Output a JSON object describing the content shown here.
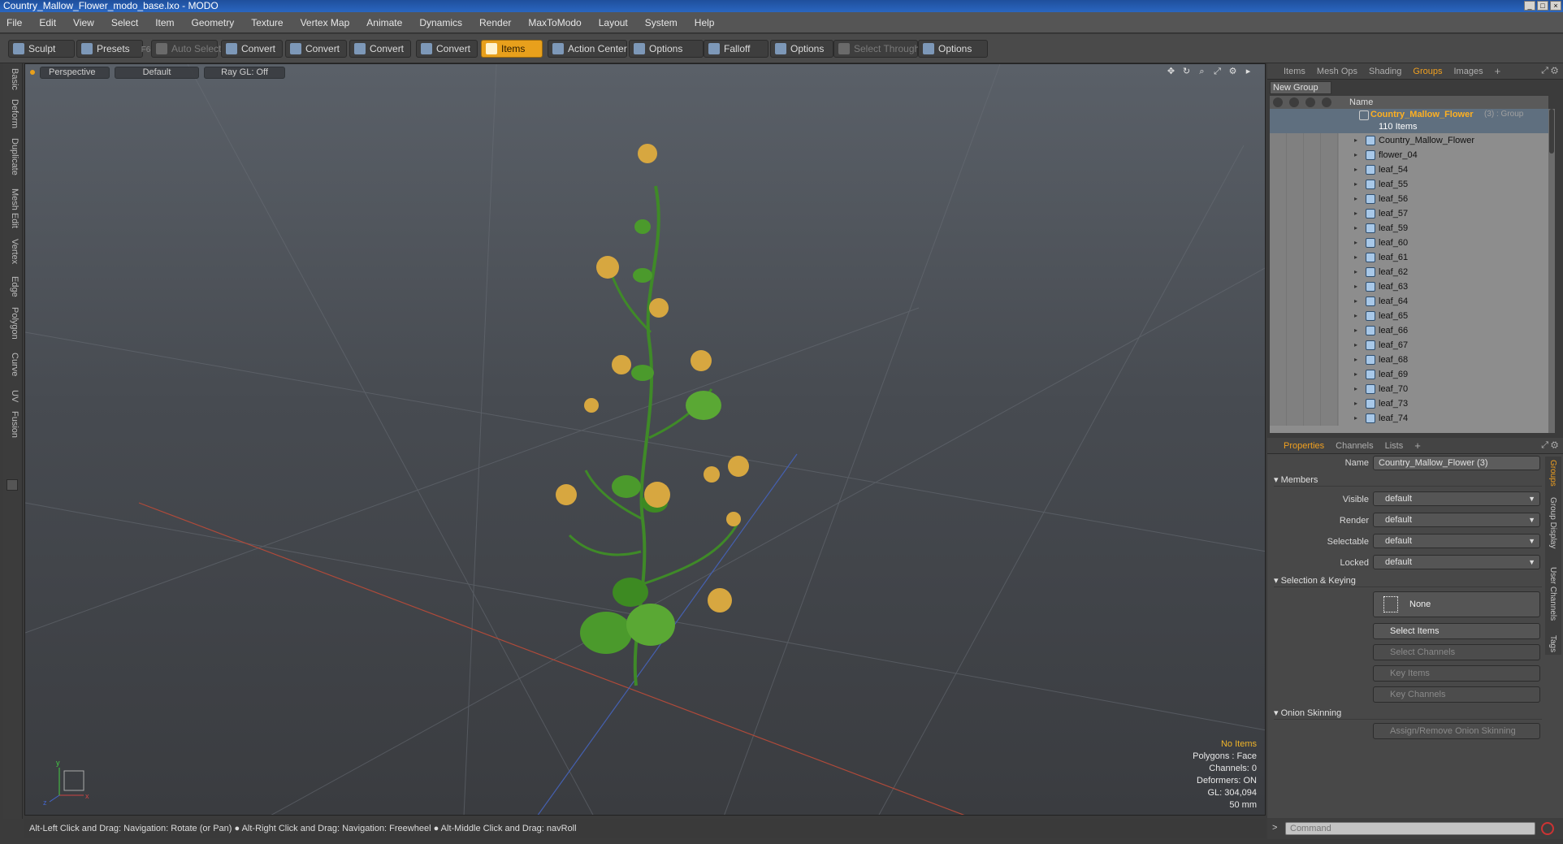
{
  "window": {
    "title": "Country_Mallow_Flower_modo_base.lxo - MODO"
  },
  "menu": [
    "File",
    "Edit",
    "View",
    "Select",
    "Item",
    "Geometry",
    "Texture",
    "Vertex Map",
    "Animate",
    "Dynamics",
    "Render",
    "MaxToModo",
    "Layout",
    "System",
    "Help"
  ],
  "toolbar": {
    "sculpt": "Sculpt",
    "presets": "Presets",
    "presets_key": "F6",
    "auto_select": "Auto Select",
    "convert1": "Convert",
    "convert2": "Convert",
    "convert3": "Convert",
    "convert4": "Convert",
    "items": "Items",
    "action_center": "Action Center",
    "options1": "Options",
    "falloff": "Falloff",
    "options2": "Options",
    "select_through": "Select Through",
    "options3": "Options"
  },
  "left_tabs": [
    "Basic",
    "Deform",
    "Duplicate",
    "Mesh Edit",
    "Vertex",
    "Edge",
    "Polygon",
    "Curve",
    "UV",
    "Fusion"
  ],
  "viewport": {
    "view": "Perspective",
    "shading": "Default",
    "raygl": "Ray GL: Off",
    "stats": {
      "selection": "No Items",
      "polygons": "Polygons : Face",
      "channels": "Channels: 0",
      "deformers": "Deformers: ON",
      "gl": "GL: 304,094",
      "scale": "50 mm"
    },
    "axis_labels": {
      "x": "x",
      "y": "y",
      "z": "z"
    }
  },
  "statusbar": "Alt-Left Click and Drag: Navigation: Rotate (or Pan) ● Alt-Right Click and Drag: Navigation: Freewheel ● Alt-Middle Click and Drag: navRoll",
  "top_panel": {
    "tabs": [
      "Items",
      "Mesh Ops",
      "Shading",
      "Groups",
      "Images"
    ],
    "active_tab": "Groups",
    "new_group": "New Group",
    "column_name": "Name",
    "group": {
      "name": "Country_Mallow_Flower",
      "suffix": "(3) : Group",
      "count": "110 Items"
    },
    "items": [
      "Country_Mallow_Flower",
      "flower_04",
      "leaf_54",
      "leaf_55",
      "leaf_56",
      "leaf_57",
      "leaf_59",
      "leaf_60",
      "leaf_61",
      "leaf_62",
      "leaf_63",
      "leaf_64",
      "leaf_65",
      "leaf_66",
      "leaf_67",
      "leaf_68",
      "leaf_69",
      "leaf_70",
      "leaf_73",
      "leaf_74"
    ]
  },
  "properties": {
    "tabs": [
      "Properties",
      "Channels",
      "Lists"
    ],
    "active_tab": "Properties",
    "name_label": "Name",
    "name_value": "Country_Mallow_Flower (3)",
    "members": "Members",
    "visible_label": "Visible",
    "visible": "default",
    "render_label": "Render",
    "render": "default",
    "selectable_label": "Selectable",
    "selectable": "default",
    "locked_label": "Locked",
    "locked": "default",
    "selection_keying": "Selection & Keying",
    "none": "None",
    "select_items": "Select Items",
    "select_channels": "Select Channels",
    "key_items": "Key Items",
    "key_channels": "Key Channels",
    "onion": "Onion Skinning",
    "assign_onion": "Assign/Remove Onion Skinning",
    "side_tabs": [
      "Groups",
      "Group Display",
      "User Channels",
      "Tags"
    ]
  },
  "command": {
    "placeholder": "Command"
  },
  "colors": {
    "accent": "#e8a01c",
    "title_bar": "#2a66c0",
    "group_name": "#ffb020"
  }
}
